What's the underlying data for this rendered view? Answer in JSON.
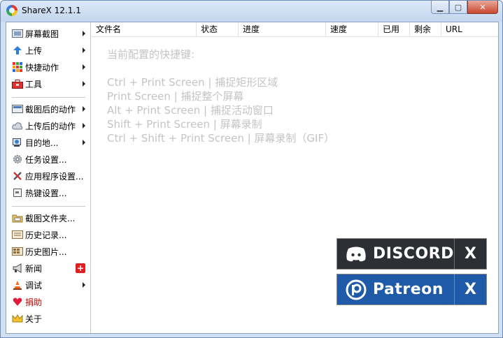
{
  "window": {
    "title": "ShareX 12.1.1"
  },
  "caption": {
    "minimize": "▁",
    "maximize": "▢",
    "close": "✕"
  },
  "sidebar": {
    "items": [
      {
        "label": "屏幕截图",
        "icon": "screenshot-icon",
        "submenu": true
      },
      {
        "label": "上传",
        "icon": "upload-arrow-icon",
        "submenu": true
      },
      {
        "label": "快捷动作",
        "icon": "grid-icon",
        "submenu": true
      },
      {
        "label": "工具",
        "icon": "toolbox-icon",
        "submenu": true
      },
      {
        "label": "截图后的动作",
        "icon": "after-capture-icon",
        "submenu": true
      },
      {
        "label": "上传后的动作",
        "icon": "cloud-upload-icon",
        "submenu": true
      },
      {
        "label": "目的地...",
        "icon": "globe-icon",
        "submenu": true
      },
      {
        "label": "任务设置...",
        "icon": "gear-icon",
        "submenu": false
      },
      {
        "label": "应用程序设置...",
        "icon": "wrench-icon",
        "submenu": false
      },
      {
        "label": "热键设置...",
        "icon": "keyboard-icon",
        "submenu": false
      },
      {
        "label": "截图文件夹...",
        "icon": "folder-icon",
        "submenu": false
      },
      {
        "label": "历史记录...",
        "icon": "history-icon",
        "submenu": false
      },
      {
        "label": "历史图片...",
        "icon": "image-history-icon",
        "submenu": false
      },
      {
        "label": "新闻",
        "icon": "megaphone-icon",
        "submenu": false,
        "badge": "+"
      },
      {
        "label": "调试",
        "icon": "traffic-cone-icon",
        "submenu": true
      },
      {
        "label": "捐助",
        "icon": "heart-icon",
        "submenu": false,
        "red": true
      },
      {
        "label": "关于",
        "icon": "crown-icon",
        "submenu": false
      }
    ]
  },
  "list": {
    "columns": [
      "文件名",
      "状态",
      "进度",
      "速度",
      "已用",
      "剩余",
      "URL"
    ]
  },
  "hotkeys": {
    "title": "当前配置的快捷键:",
    "lines": [
      "Ctrl + Print Screen  |  捕捉矩形区域",
      "Print Screen  |  捕捉整个屏幕",
      "Alt + Print Screen  |  捕捉活动窗口",
      "Shift + Print Screen  |  屏幕录制",
      "Ctrl + Shift + Print Screen  |  屏幕录制（GIF）"
    ]
  },
  "promos": {
    "discord": {
      "label": "DISCORD",
      "close": "X",
      "color": "#2c2f33"
    },
    "patreon": {
      "label": "Patreon",
      "close": "X",
      "color": "#1e5aa8"
    }
  },
  "colors": {
    "accent": "#1e5aa8",
    "hint": "#c4c4c4",
    "donate": "#cc0000"
  }
}
